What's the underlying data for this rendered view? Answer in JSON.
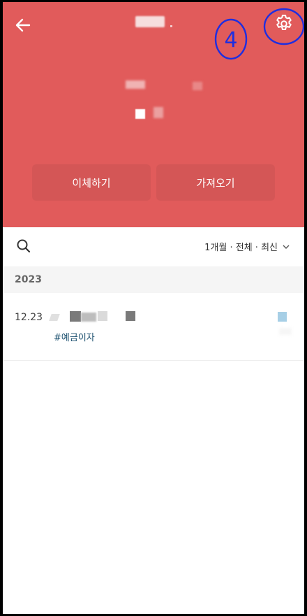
{
  "header": {
    "back_icon": "arrow-left-icon",
    "settings_icon": "gear-icon",
    "annotation_text": "4",
    "annotation_color": "#1f2ee0",
    "bg_color": "#e15b5b",
    "buttons": {
      "transfer_label": "이체하기",
      "import_label": "가져오기"
    }
  },
  "filter": {
    "search_icon": "search-icon",
    "selection_label": "1개월 · 전체 · 최신",
    "chevron_icon": "chevron-down-icon"
  },
  "list": {
    "groups": [
      {
        "year": "2023",
        "items": [
          {
            "date": "12.23",
            "tag": "#예금이자"
          }
        ]
      }
    ]
  }
}
